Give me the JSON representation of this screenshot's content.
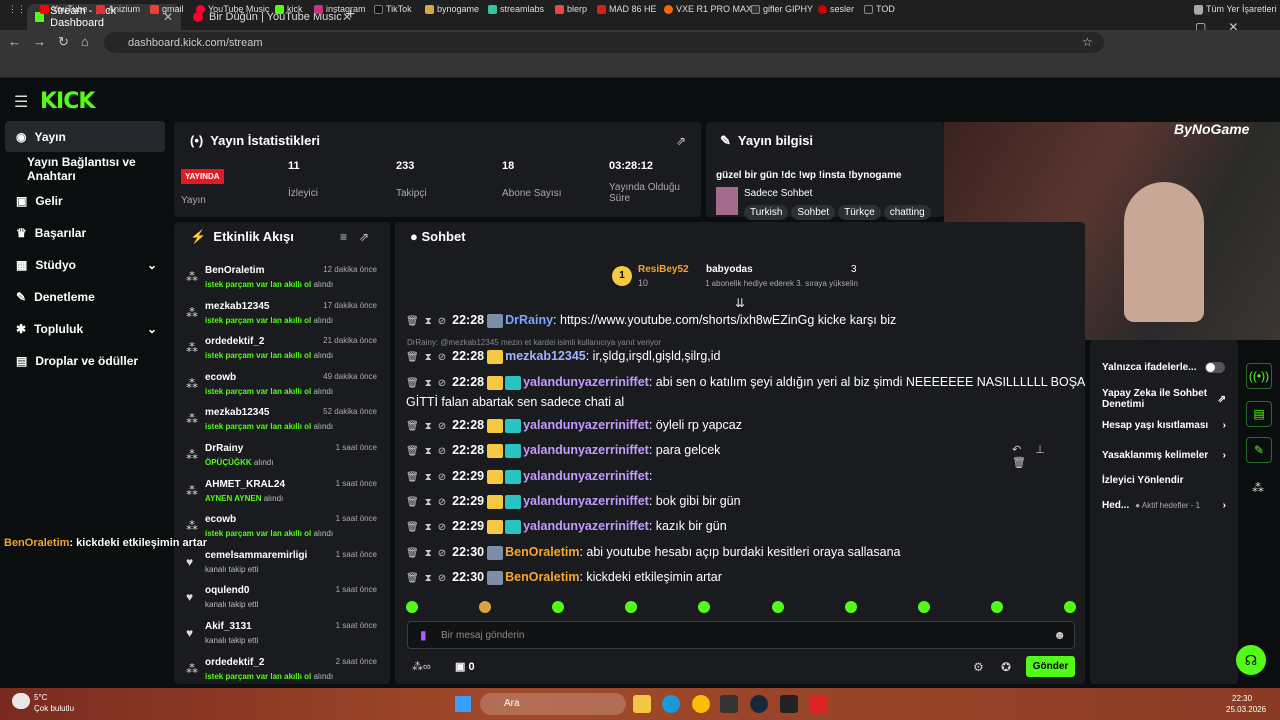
{
  "browser": {
    "tabs": [
      {
        "label": "Stream - Kick Dashboard"
      },
      {
        "label": "Bir Düğün | YouTube Music"
      }
    ],
    "url": "dashboard.kick.com/stream",
    "bookmarks": [
      "YouTube",
      "Anizium",
      "gmail",
      "YouTube Music",
      "kick",
      "instagram",
      "TikTok",
      "bynogame",
      "streamlabs",
      "blerp",
      "MAD 86 HE",
      "VXE R1 PRO MAX",
      "gifler GIPHY",
      "sesler",
      "TOD"
    ],
    "all_bookmarks": "Tüm Yer İşaretleri"
  },
  "sidebar": {
    "logo": "KICK",
    "items": [
      {
        "label": "Yayın",
        "icon": "broadcast-icon"
      },
      {
        "label": "Yayın Bağlantısı ve Anahtarı"
      },
      {
        "label": "Gelir",
        "icon": "money-icon"
      },
      {
        "label": "Başarılar",
        "icon": "trophy-icon"
      },
      {
        "label": "Stüdyo",
        "icon": "studio-icon"
      },
      {
        "label": "Denetleme",
        "icon": "wrench-icon"
      },
      {
        "label": "Topluluk",
        "icon": "community-icon"
      },
      {
        "label": "Droplar ve ödüller",
        "icon": "drops-icon"
      }
    ]
  },
  "stats": {
    "title": "Yayın İstatistikleri",
    "live_badge": "YAYINDA",
    "live_label": "Yayın",
    "items": [
      {
        "value": "11",
        "label": "İzleyici"
      },
      {
        "value": "233",
        "label": "Takipçi"
      },
      {
        "value": "18",
        "label": "Abone Sayısı"
      },
      {
        "value": "03:28:12",
        "label": "Yayında Olduğu Süre"
      }
    ]
  },
  "info": {
    "title": "Yayın bilgisi",
    "stream_title": "güzel bir gün !dc !wp !insta !bynogame",
    "category": "Sadece Sohbet",
    "tags": [
      "Turkish",
      "Sohbet",
      "Türkçe",
      "chatting"
    ],
    "brand": "ByNoGame"
  },
  "activity": {
    "title": "Etkinlik Akışı",
    "events": [
      {
        "user": "BenOraletim",
        "time": "12 dakika önce",
        "reward": "istek parçam var lan akıllı ol",
        "suffix": "alındı"
      },
      {
        "user": "mezkab12345",
        "time": "17 dakika önce",
        "reward": "istek parçam var lan akıllı ol",
        "suffix": "alındı"
      },
      {
        "user": "ordedektif_2",
        "time": "21 dakika önce",
        "reward": "istek parçam var lan akıllı ol",
        "suffix": "alındı"
      },
      {
        "user": "ecowb",
        "time": "49 dakika önce",
        "reward": "istek parçam var lan akıllı ol",
        "suffix": "alındı"
      },
      {
        "user": "mezkab12345",
        "time": "52 dakika önce",
        "reward": "istek parçam var lan akıllı ol",
        "suffix": "alındı"
      },
      {
        "user": "DrRainy",
        "time": "1 saat önce",
        "reward": "ÖPÜÇÜĞKK",
        "suffix": "alındı"
      },
      {
        "user": "AHMET_KRAL24",
        "time": "1 saat önce",
        "reward": "AYNEN AYNEN",
        "suffix": "alındı"
      },
      {
        "user": "ecowb",
        "time": "1 saat önce",
        "reward": "istek parçam var lan akıllı ol",
        "suffix": "alındı"
      },
      {
        "user": "cemelsammaremirligi",
        "time": "1 saat önce",
        "reward": "",
        "suffix": "kanalı takip etti"
      },
      {
        "user": "oqulend0",
        "time": "1 saat önce",
        "reward": "",
        "suffix": "kanalı takip etti"
      },
      {
        "user": "Akif_3131",
        "time": "1 saat önce",
        "reward": "",
        "suffix": "kanalı takip etti"
      },
      {
        "user": "ordedektif_2",
        "time": "2 saat önce",
        "reward": "istek parçam var lan akıllı ol",
        "suffix": "alındı"
      }
    ]
  },
  "overlay": {
    "user": "BenOraletim",
    "text": ": kickdeki etkileşimin artar"
  },
  "chat": {
    "title": "Sohbet",
    "pinned": {
      "user": "ResiBey52",
      "count": "10",
      "gifter": "babyodas",
      "gift_count": "3",
      "gift_text": "1 abonelik hediye ederek 3. sıraya yükselin"
    },
    "reply_hint": "DrRainy: @mezkab12345 mezin et kardei isimli kullanıcıya yanıt veriyor",
    "messages": [
      {
        "time": "22:28",
        "user": "DrRainy",
        "color": "#7ba6ff",
        "text": ": https://www.youtube.com/shorts/ixh8wEZinGg kicke karşı biz"
      },
      {
        "time": "22:28",
        "user": "mezkab12345",
        "color": "#9fb5ff",
        "text": ": ir,şldg,irşdl,gişld,şilrg,id"
      },
      {
        "time": "22:28",
        "user": "yalandunyazerriniffet",
        "color": "#c59bff",
        "text": ": abi sen o katılım şeyi aldığın yeri al biz şimdi NEEEEEEE NASILLLLLL BOŞA GİTTİ falan abartak sen sadece chati al"
      },
      {
        "time": "22:28",
        "user": "yalandunyazerriniffet",
        "color": "#c59bff",
        "text": ": öyleli rp yapcaz"
      },
      {
        "time": "22:28",
        "user": "yalandunyazerriniffet",
        "color": "#c59bff",
        "text": ": para gelcek"
      },
      {
        "time": "22:29",
        "user": "yalandunyazerriniffet",
        "color": "#c59bff",
        "text": ":"
      },
      {
        "time": "22:29",
        "user": "yalandunyazerriniffet",
        "color": "#c59bff",
        "text": ": bok gibi bir gün"
      },
      {
        "time": "22:29",
        "user": "yalandunyazerriniffet",
        "color": "#c59bff",
        "text": ": kazık bir gün"
      },
      {
        "time": "22:30",
        "user": "BenOraletim",
        "color": "#f7a62a",
        "text": ": abi youtube hesabı açıp burdaki kesitleri oraya sallasana"
      },
      {
        "time": "22:30",
        "user": "BenOraletim",
        "color": "#f7a62a",
        "text": ": kickdeki etkileşimin artar"
      }
    ],
    "input_placeholder": "Bir mesaj gönderin",
    "points": "0",
    "send": "Gönder"
  },
  "right": {
    "items": [
      {
        "label": "Yalnızca ifadelerle..."
      },
      {
        "label": "Yapay Zeka ile Sohbet Denetimi"
      },
      {
        "label": "Hesap yaşı kısıtlaması"
      },
      {
        "label": "Yasaklanmış kelimeler"
      },
      {
        "label": "İzleyici Yönlendir"
      },
      {
        "label": "Hed..."
      }
    ],
    "goal_text": "Aktif hedefler - 1"
  },
  "taskbar": {
    "weather_temp": "5°C",
    "weather_desc": "Çok bulutlu",
    "search": "Ara",
    "time": "22:30",
    "date": "25.03.2026"
  }
}
